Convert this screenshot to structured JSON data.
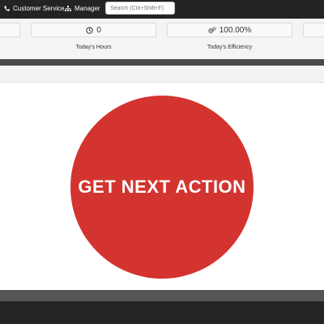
{
  "topbar": {
    "customer_service_label": "Customer Service",
    "manager_label": "Manager",
    "search_placeholder": "Search (Ctrl+Shift+F)"
  },
  "stats": {
    "hours": {
      "value": "0",
      "label": "Today's Hours",
      "icon": "clock-icon"
    },
    "efficiency": {
      "value": "100.00%",
      "label": "Today's Efficiency",
      "icon": "gears-icon"
    }
  },
  "main": {
    "action_button_label": "GET NEXT ACTION",
    "action_button_color": "#d3342f"
  }
}
